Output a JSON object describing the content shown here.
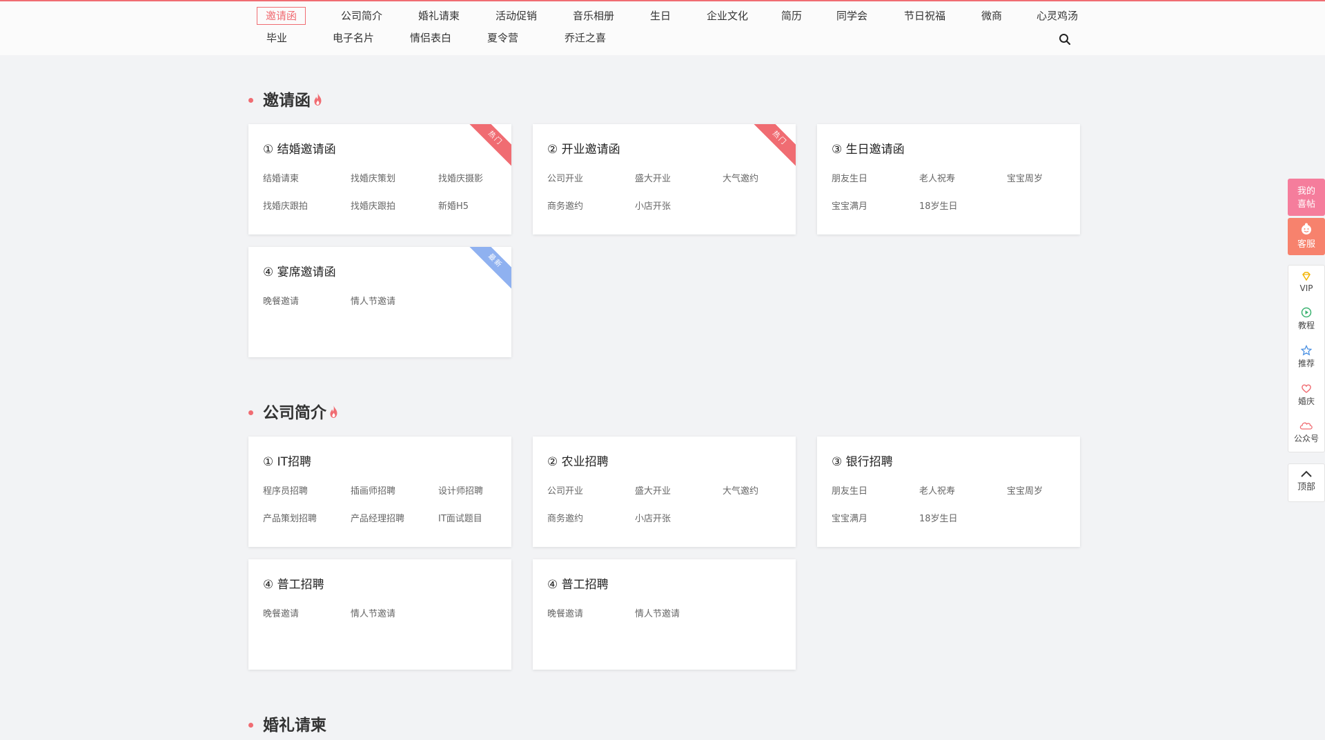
{
  "nav": {
    "row1": [
      "邀请函",
      "公司简介",
      "婚礼请柬",
      "活动促销",
      "音乐相册",
      "生日",
      "企业文化",
      "简历",
      "同学会",
      "节日祝福",
      "微商",
      "心灵鸡汤"
    ],
    "row2": [
      "毕业",
      "电子名片",
      "情侣表白",
      "夏令营",
      "乔迁之喜"
    ]
  },
  "sections": [
    {
      "title": "邀请函",
      "cards": [
        {
          "title": "① 结婚邀请函",
          "badge": "热门",
          "links": [
            "结婚请柬",
            "找婚庆策划",
            "找婚庆摄影",
            "找婚庆跟拍",
            "找婚庆跟拍",
            "新婚H5"
          ]
        },
        {
          "title": "② 开业邀请函",
          "badge": "热门",
          "links": [
            "公司开业",
            "盛大开业",
            "大气邀约",
            "商务邀约",
            "小店开张"
          ]
        },
        {
          "title": "③ 生日邀请函",
          "badge": "",
          "links": [
            "朋友生日",
            "老人祝寿",
            "宝宝周岁",
            "宝宝满月",
            "18岁生日"
          ]
        },
        {
          "title": "④ 宴席邀请函",
          "badge": "最新",
          "links": [
            "晚餐邀请",
            "情人节邀请"
          ]
        }
      ]
    },
    {
      "title": "公司简介",
      "cards": [
        {
          "title": "① IT招聘",
          "badge": "",
          "links": [
            "程序员招聘",
            "插画师招聘",
            "设计师招聘",
            "产品策划招聘",
            "产品经理招聘",
            "IT面试题目"
          ]
        },
        {
          "title": "② 农业招聘",
          "badge": "",
          "links": [
            "公司开业",
            "盛大开业",
            "大气邀约",
            "商务邀约",
            "小店开张"
          ]
        },
        {
          "title": "③ 银行招聘",
          "badge": "",
          "links": [
            "朋友生日",
            "老人祝寿",
            "宝宝周岁",
            "宝宝满月",
            "18岁生日"
          ]
        },
        {
          "title": "④ 普工招聘",
          "badge": "",
          "links": [
            "晚餐邀请",
            "情人节邀请"
          ]
        },
        {
          "title": "④ 普工招聘",
          "badge": "",
          "links": [
            "晚餐邀请",
            "情人节邀请"
          ]
        }
      ]
    },
    {
      "title": "婚礼请柬",
      "cards": []
    }
  ],
  "sidebar": {
    "my_site": [
      "我的",
      "喜帖"
    ],
    "service": "客服",
    "items": [
      "VIP",
      "教程",
      "推荐",
      "婚庆",
      "公众号"
    ],
    "top": "顶部"
  },
  "colors": {
    "accent": "#f06c72",
    "new_badge": "#8fb1f0",
    "service": "#f7826d",
    "my_site": "#f57d9c"
  }
}
